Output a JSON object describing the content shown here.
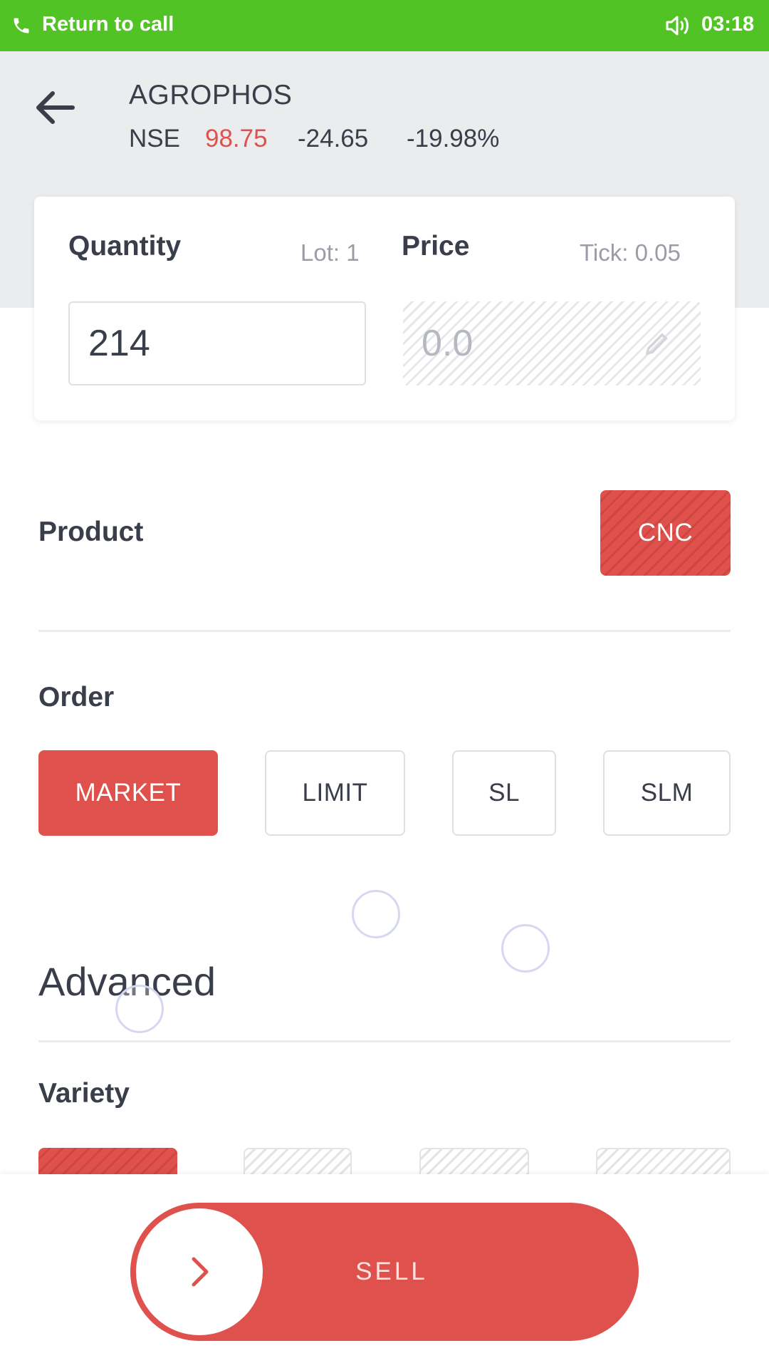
{
  "status_bar": {
    "call_label": "Return to call",
    "time": "03:18"
  },
  "instrument": {
    "symbol": "AGROPHOS",
    "exchange": "NSE",
    "ltp": "98.75",
    "change": "-24.65",
    "change_pct": "-19.98%"
  },
  "quantity": {
    "label": "Quantity",
    "lot_label": "Lot: 1",
    "value": "214"
  },
  "price": {
    "label": "Price",
    "tick_label": "Tick: 0.05",
    "value": "0.0",
    "disabled": true
  },
  "product": {
    "label": "Product",
    "selected": "CNC"
  },
  "order": {
    "label": "Order",
    "types": [
      "MARKET",
      "LIMIT",
      "SL",
      "SLM"
    ],
    "selected": "MARKET"
  },
  "advanced": {
    "label": "Advanced"
  },
  "variety": {
    "label": "Variety"
  },
  "action": {
    "label": "SELL"
  },
  "colors": {
    "call_green": "#52c325",
    "sell_red": "#df514c",
    "text_dark": "#3a3d4a",
    "text_muted": "#9a9ca8",
    "header_bg": "#ebecee"
  }
}
